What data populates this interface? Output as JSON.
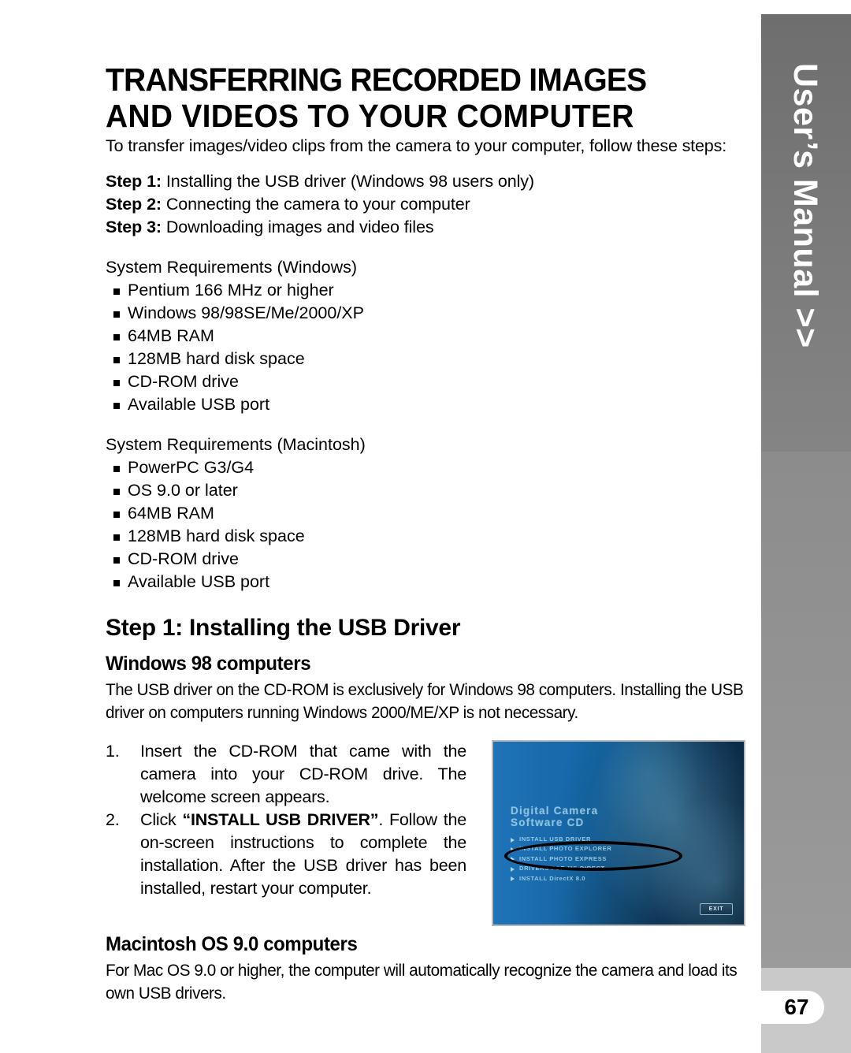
{
  "page": {
    "number": "67",
    "side_tab_label": "User’s Manual >>"
  },
  "title": {
    "line1": "TRANSFERRING RECORDED IMAGES",
    "line2": "AND VIDEOS TO YOUR COMPUTER"
  },
  "intro": "To transfer images/video clips from the camera to your computer, follow these steps:",
  "steps": [
    {
      "label": "Step 1:",
      "text": " Installing the USB driver (Windows 98 users only)"
    },
    {
      "label": "Step 2:",
      "text": " Connecting the camera to your computer"
    },
    {
      "label": "Step 3:",
      "text": " Downloading images and video files"
    }
  ],
  "requirements_windows": {
    "title": "System Requirements (Windows)",
    "items": [
      "Pentium 166 MHz or higher",
      "Windows 98/98SE/Me/2000/XP",
      "64MB RAM",
      "128MB hard disk space",
      "CD-ROM drive",
      "Available USB port"
    ]
  },
  "requirements_macintosh": {
    "title": "System Requirements (Macintosh)",
    "items": [
      "PowerPC G3/G4",
      "OS 9.0 or later",
      "64MB RAM",
      "128MB hard disk space",
      "CD-ROM drive",
      "Available USB port"
    ]
  },
  "step1": {
    "heading": "Step 1: Installing the USB Driver",
    "windows_sub": "Windows 98 computers",
    "windows_para": "The USB driver on the CD-ROM is exclusively for Windows 98 computers. Installing the USB driver on computers running Windows 2000/ME/XP is not necessary.",
    "numbered": [
      {
        "num": "1.",
        "pre": "Insert the CD-ROM that came with the camera into your CD-ROM drive. The welcome screen appears.",
        "bold": "",
        "post": ""
      },
      {
        "num": "2.",
        "pre": "Click ",
        "bold": "“INSTALL USB DRIVER”",
        "post": ". Follow the on-screen instructions to complete the installation. After the USB driver has been installed, restart your computer."
      }
    ]
  },
  "cd_screenshot": {
    "title_line1": "Digital Camera",
    "title_line2": "Software CD",
    "menu": [
      "INSTALL USB DRIVER",
      "INSTALL PHOTO EXPLORER",
      "INSTALL PHOTO EXPRESS",
      "DRIVERS FOR MS-DIRECT",
      "INSTALL DirectX 8.0"
    ],
    "exit_label": "EXIT"
  },
  "macintosh": {
    "sub": "Macintosh OS 9.0 computers",
    "para": " For Mac OS 9.0 or higher, the computer will automatically recognize the camera and load its own USB drivers."
  }
}
